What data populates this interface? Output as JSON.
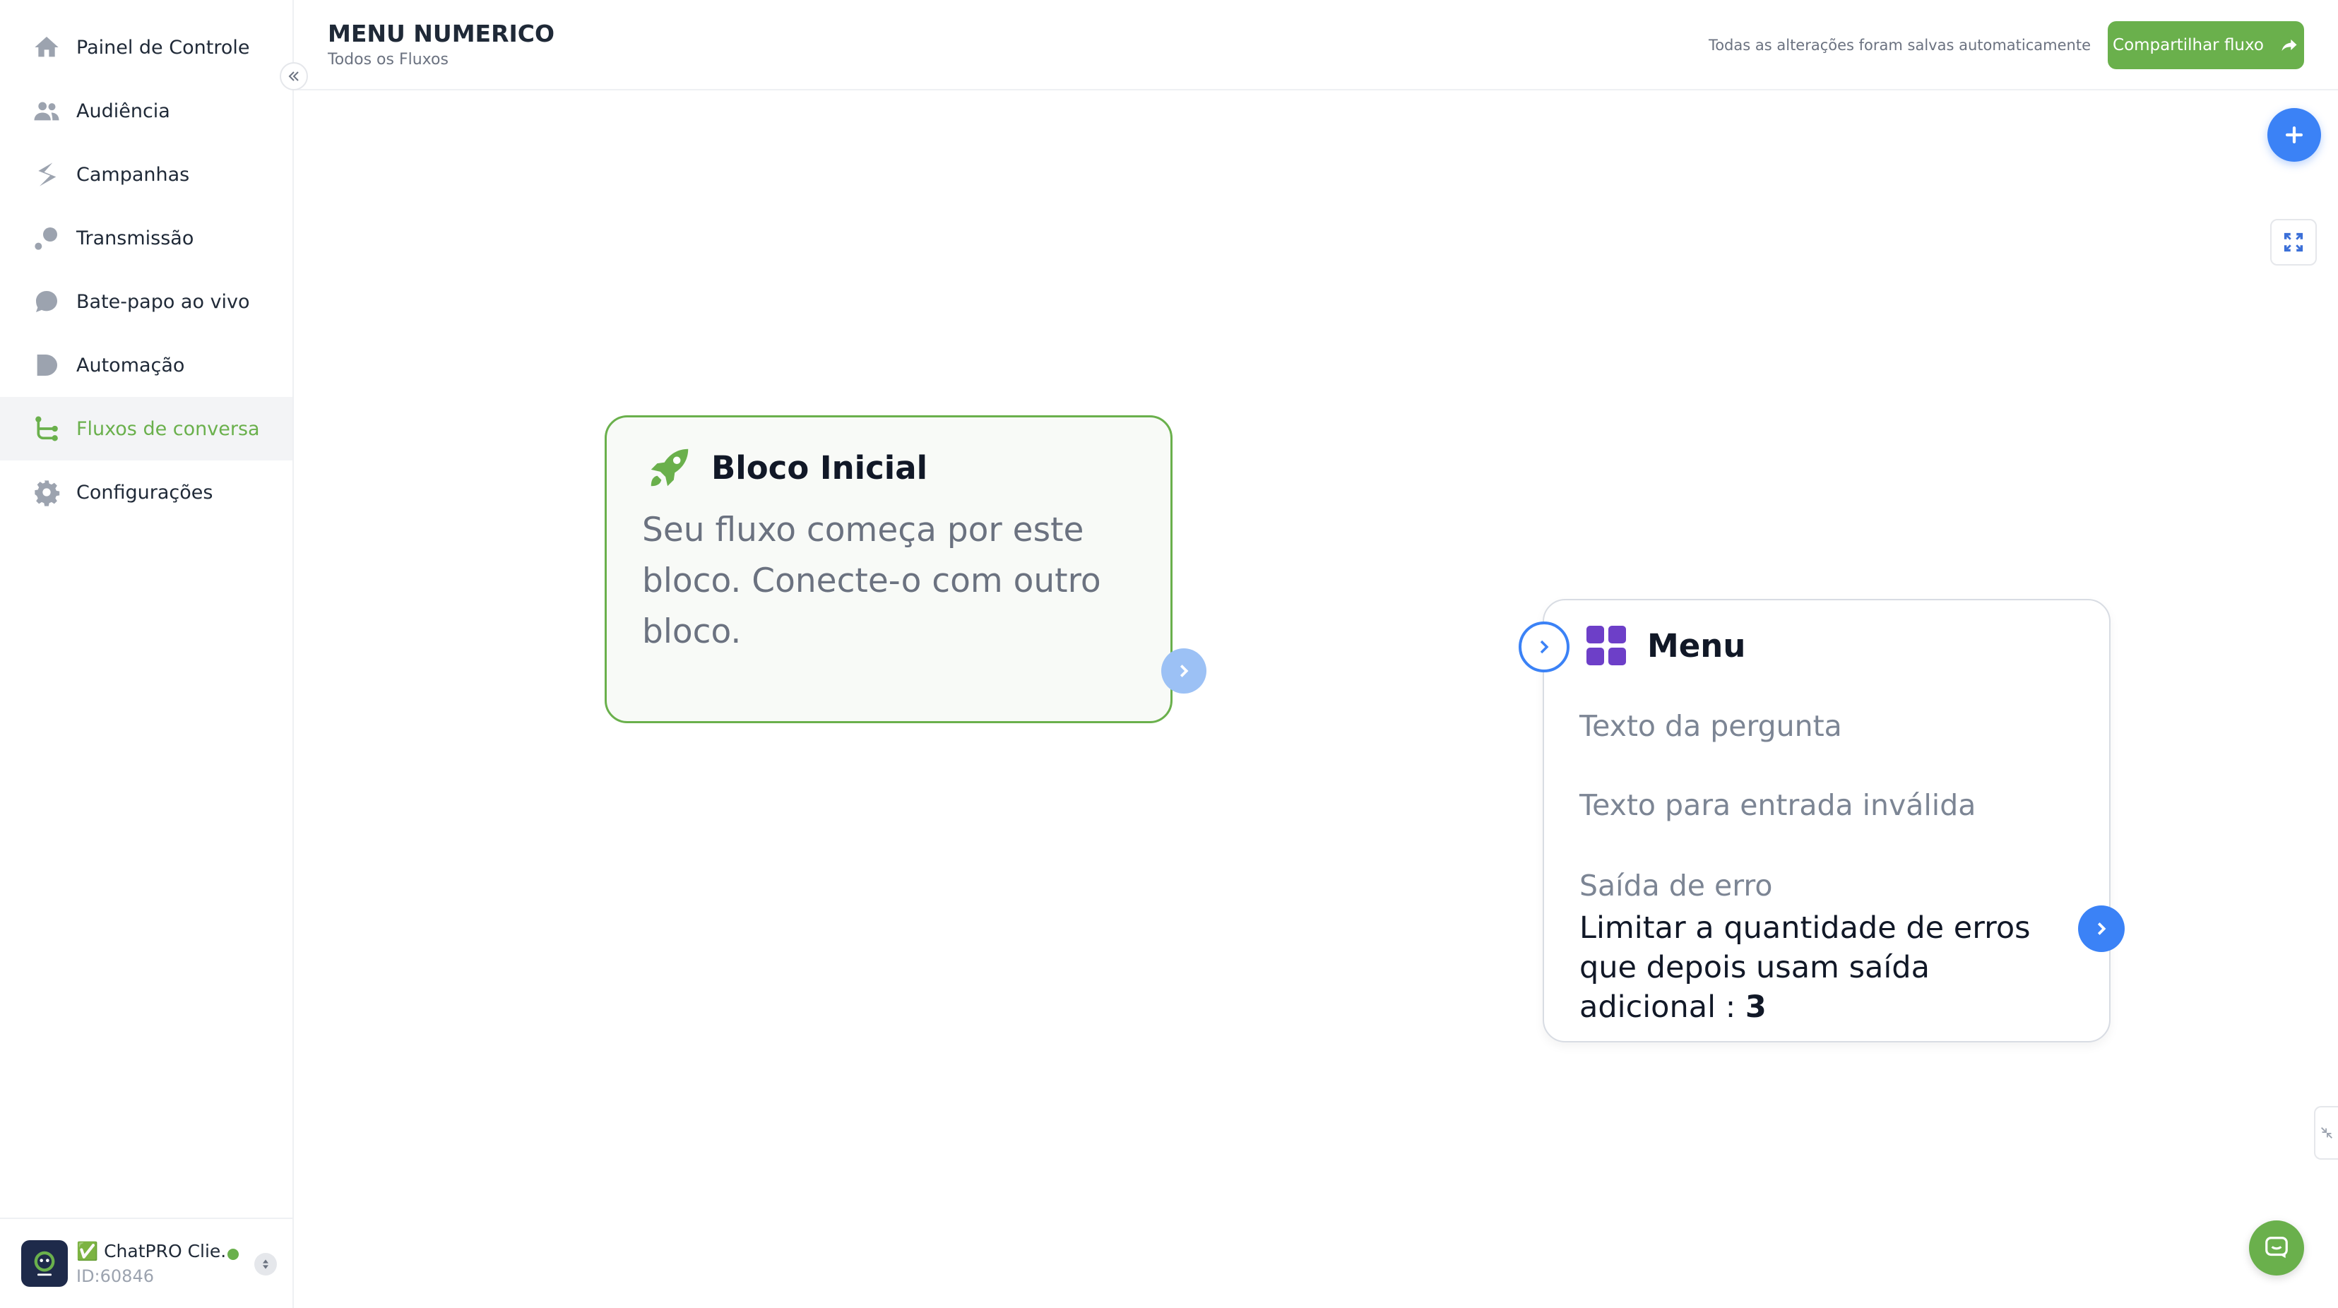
{
  "sidebar": {
    "items": [
      {
        "label": "Painel de Controle",
        "icon": "home-icon"
      },
      {
        "label": "Audiência",
        "icon": "users-icon"
      },
      {
        "label": "Campanhas",
        "icon": "campaign-icon"
      },
      {
        "label": "Transmissão",
        "icon": "broadcast-icon"
      },
      {
        "label": "Bate-papo ao vivo",
        "icon": "chat-bubble-icon"
      },
      {
        "label": "Automação",
        "icon": "automation-icon"
      },
      {
        "label": "Fluxos de conversa",
        "icon": "flow-icon",
        "active": true
      },
      {
        "label": "Configurações",
        "icon": "gear-icon"
      }
    ],
    "account": {
      "name": "✅ ChatPRO Clie...",
      "id": "ID:60846",
      "status": "online"
    }
  },
  "header": {
    "title": "MENU NUMERICO",
    "breadcrumb": "Todos os Fluxos",
    "autosave_text": "Todas as alterações foram salvas automaticamente",
    "share_label": "Compartilhar fluxo"
  },
  "blocks": {
    "start": {
      "title": "Bloco Inicial",
      "description": "Seu fluxo começa por este bloco. Conecte-o com outro bloco.",
      "icon": "rocket-icon"
    },
    "menu": {
      "title": "Menu",
      "icon": "grid-icon",
      "question_placeholder": "Texto da pergunta",
      "invalid_placeholder": "Texto para entrada inválida",
      "error_output_label": "Saída de erro",
      "error_limit_text": "Limitar a quantidade de erros que depois usam saída adicional : ",
      "error_limit_value": "3"
    }
  },
  "colors": {
    "brand_green": "#6ab04c",
    "accent_blue": "#3b82f6",
    "menu_icon_purple": "#6d3fc8"
  }
}
